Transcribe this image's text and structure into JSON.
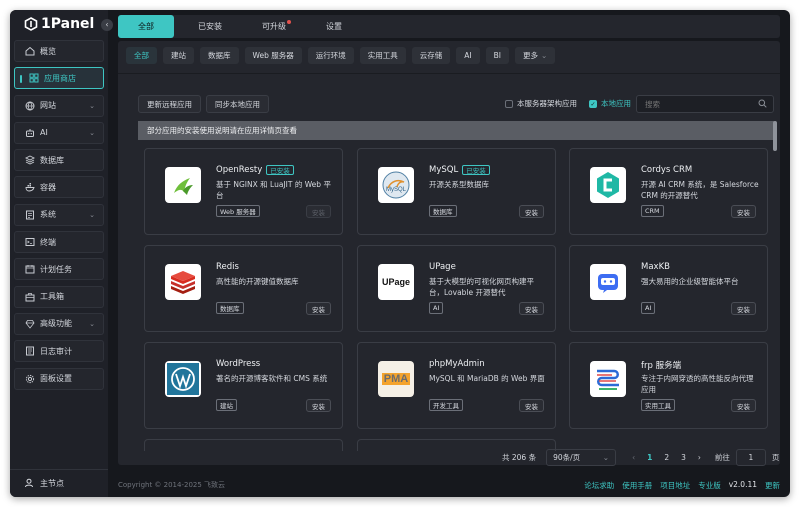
{
  "brand": "1Panel",
  "sidebar": {
    "items": [
      {
        "label": "概览",
        "icon": "home-icon"
      },
      {
        "label": "应用商店",
        "icon": "apps-icon",
        "active": true
      },
      {
        "label": "网站",
        "icon": "globe-icon",
        "expand": true
      },
      {
        "label": "AI",
        "icon": "ai-icon",
        "expand": true
      },
      {
        "label": "数据库",
        "icon": "database-icon"
      },
      {
        "label": "容器",
        "icon": "container-icon"
      },
      {
        "label": "系统",
        "icon": "system-icon",
        "expand": true
      },
      {
        "label": "终端",
        "icon": "terminal-icon"
      },
      {
        "label": "计划任务",
        "icon": "calendar-icon"
      },
      {
        "label": "工具箱",
        "icon": "toolbox-icon"
      },
      {
        "label": "高级功能",
        "icon": "diamond-icon",
        "expand": true
      },
      {
        "label": "日志审计",
        "icon": "log-icon"
      },
      {
        "label": "面板设置",
        "icon": "settings-icon"
      }
    ],
    "footer": "主节点"
  },
  "top_tabs": [
    "全部",
    "已安装",
    "可升级",
    "设置"
  ],
  "categories": [
    "全部",
    "建站",
    "数据库",
    "Web 服务器",
    "运行环境",
    "实用工具",
    "云存储",
    "AI",
    "BI",
    "更多"
  ],
  "toolbar": {
    "update_remote": "更新远程应用",
    "sync_local": "同步本地应用",
    "arch_filter": "本服务器架构应用",
    "local_apps": "本地应用",
    "search_placeholder": "搜索"
  },
  "notice": "部分应用的安装使用说明请在应用详情页查看",
  "installed_label": "已安装",
  "install_label": "安装",
  "apps": [
    {
      "name": "OpenResty",
      "installed": true,
      "desc": "基于 NGINX 和 LuaJIT 的 Web 平台",
      "tag": "Web 服务器",
      "install_disabled": true
    },
    {
      "name": "MySQL",
      "installed": true,
      "desc": "开源关系型数据库",
      "tag": "数据库"
    },
    {
      "name": "Cordys CRM",
      "installed": false,
      "desc": "开源 AI CRM 系统，是 Salesforce CRM 的开源替代",
      "tag": "CRM"
    },
    {
      "name": "Redis",
      "installed": false,
      "desc": "高性能的开源键值数据库",
      "tag": "数据库"
    },
    {
      "name": "UPage",
      "installed": false,
      "desc": "基于大模型的可视化网页构建平台，Lovable 开源替代",
      "tag": "AI",
      "logo_text": "UPage"
    },
    {
      "name": "MaxKB",
      "installed": false,
      "desc": "强大易用的企业级智能体平台",
      "tag": "AI"
    },
    {
      "name": "WordPress",
      "installed": false,
      "desc": "著名的开源博客软件和 CMS 系统",
      "tag": "建站"
    },
    {
      "name": "phpMyAdmin",
      "installed": false,
      "desc": "MySQL 和 MariaDB 的 Web 界面",
      "tag": "开发工具",
      "logo_text": "PMA"
    },
    {
      "name": "frp 服务端",
      "installed": false,
      "desc": "专注于内网穿透的高性能反向代理应用",
      "tag": "实用工具"
    }
  ],
  "pager": {
    "total": "共 206 条",
    "page_size": "90条/页",
    "pages": [
      "1",
      "2",
      "3"
    ],
    "current": "1",
    "goto_label": "前往",
    "goto_value": "1",
    "page_suffix": "页"
  },
  "footer": {
    "copyright": "Copyright © 2014-2025 飞致云",
    "links": [
      "论坛求助",
      "使用手册",
      "项目地址"
    ],
    "edition": "专业版",
    "version": "v2.0.11",
    "update": "更新"
  },
  "colors": {
    "accent": "#3ec6c3",
    "background": "#16181d",
    "panel": "#24262d"
  }
}
